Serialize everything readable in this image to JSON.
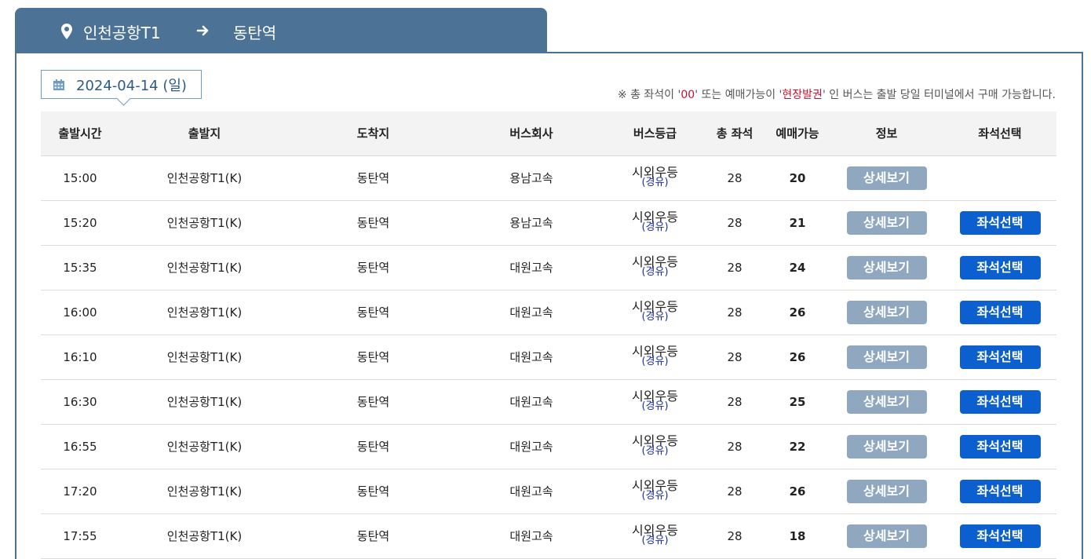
{
  "route": {
    "origin": "인천공항T1",
    "destination": "동탄역",
    "pin_icon": "map-pin-icon",
    "arrow_icon": "arrow-right-icon"
  },
  "date": {
    "value": "2024-04-14 (일)",
    "icon": "calendar-icon"
  },
  "notice": {
    "part1": "※ 총 좌석이 '",
    "zero": "00",
    "part2": "' 또는 예매가능이 '",
    "onsite": "현장발권",
    "part3": "' 인 버스는 출발 당일 터미널에서 구매 가능합니다."
  },
  "colors": {
    "header_blue": "#4c7396",
    "seat_button": "#0b5fce",
    "detail_button": "#8fa8c0",
    "notice_red": "#c8102e"
  },
  "table": {
    "headers": [
      "출발시간",
      "출발지",
      "도착지",
      "버스회사",
      "버스등급",
      "총 좌석",
      "예매가능",
      "정보",
      "좌석선택"
    ],
    "rows": [
      {
        "time": "15:00",
        "from": "인천공항T1(K)",
        "to": "동탄역",
        "company": "용남고속",
        "grade": "시외우등",
        "grade_sub": "(경유)",
        "total": "28",
        "available": "20",
        "detail": "상세보기",
        "seat": ""
      },
      {
        "time": "15:20",
        "from": "인천공항T1(K)",
        "to": "동탄역",
        "company": "용남고속",
        "grade": "시외우등",
        "grade_sub": "(경유)",
        "total": "28",
        "available": "21",
        "detail": "상세보기",
        "seat": "좌석선택"
      },
      {
        "time": "15:35",
        "from": "인천공항T1(K)",
        "to": "동탄역",
        "company": "대원고속",
        "grade": "시외우등",
        "grade_sub": "(경유)",
        "total": "28",
        "available": "24",
        "detail": "상세보기",
        "seat": "좌석선택"
      },
      {
        "time": "16:00",
        "from": "인천공항T1(K)",
        "to": "동탄역",
        "company": "대원고속",
        "grade": "시외우등",
        "grade_sub": "(경유)",
        "total": "28",
        "available": "26",
        "detail": "상세보기",
        "seat": "좌석선택"
      },
      {
        "time": "16:10",
        "from": "인천공항T1(K)",
        "to": "동탄역",
        "company": "대원고속",
        "grade": "시외우등",
        "grade_sub": "(경유)",
        "total": "28",
        "available": "26",
        "detail": "상세보기",
        "seat": "좌석선택"
      },
      {
        "time": "16:30",
        "from": "인천공항T1(K)",
        "to": "동탄역",
        "company": "대원고속",
        "grade": "시외우등",
        "grade_sub": "(경유)",
        "total": "28",
        "available": "25",
        "detail": "상세보기",
        "seat": "좌석선택"
      },
      {
        "time": "16:55",
        "from": "인천공항T1(K)",
        "to": "동탄역",
        "company": "대원고속",
        "grade": "시외우등",
        "grade_sub": "(경유)",
        "total": "28",
        "available": "22",
        "detail": "상세보기",
        "seat": "좌석선택"
      },
      {
        "time": "17:20",
        "from": "인천공항T1(K)",
        "to": "동탄역",
        "company": "대원고속",
        "grade": "시외우등",
        "grade_sub": "(경유)",
        "total": "28",
        "available": "26",
        "detail": "상세보기",
        "seat": "좌석선택"
      },
      {
        "time": "17:55",
        "from": "인천공항T1(K)",
        "to": "동탄역",
        "company": "대원고속",
        "grade": "시외우등",
        "grade_sub": "(경유)",
        "total": "28",
        "available": "18",
        "detail": "상세보기",
        "seat": "좌석선택"
      }
    ]
  }
}
